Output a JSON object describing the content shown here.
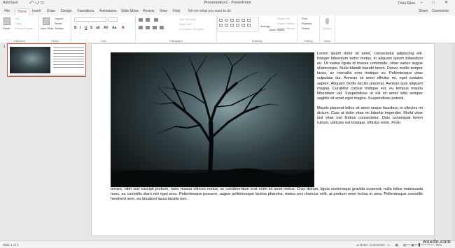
{
  "titlebar": {
    "autosave": "AutoSave",
    "qat": "⤺ ⤻ ▭",
    "title": "Presentation1 - PowerPoint",
    "user": "Tricia Goss",
    "controls": "▭ – □ ✕"
  },
  "tabs": [
    {
      "label": "File"
    },
    {
      "label": "Home"
    },
    {
      "label": "Insert"
    },
    {
      "label": "Draw"
    },
    {
      "label": "Design"
    },
    {
      "label": "Transitions"
    },
    {
      "label": "Animations"
    },
    {
      "label": "Slide Show"
    },
    {
      "label": "Review"
    },
    {
      "label": "View"
    },
    {
      "label": "Help"
    }
  ],
  "tell_me": "Tell me what you want to do",
  "share": "Share",
  "comments": "Comments",
  "ribbon": {
    "clipboard": {
      "label": "Clipboard",
      "paste": "Paste",
      "cut": "Cut",
      "copy": "Copy",
      "format_painter": "Format Painter"
    },
    "slides": {
      "label": "Slides",
      "new_slide": "New Slide",
      "layout": "Layout",
      "reset": "Reset",
      "section": "Section"
    },
    "font": {
      "label": "Font",
      "bold": "B",
      "italic": "I",
      "underline": "U",
      "strike": "S",
      "ab": "ab",
      "av": "AV",
      "aa": "Aa",
      "a": "A"
    },
    "paragraph": {
      "label": "Paragraph",
      "text_direction": "Text Direction",
      "align_text": "Align Text",
      "convert_smartart": "Convert to SmartArt"
    },
    "drawing": {
      "label": "Drawing",
      "arrange": "Arrange",
      "quick_styles": "Quick Styles",
      "shape_fill": "Shape Fill",
      "shape_outline": "Shape Outline",
      "shape_effects": "Shape Effects"
    },
    "editing": {
      "label": "Editing",
      "find": "Find",
      "replace": "Replace",
      "select": "Select"
    },
    "voice": {
      "label": "Voice",
      "dictate": "Dictate"
    }
  },
  "thumbnail": {
    "number": "1"
  },
  "slide": {
    "side_paragraphs": [
      "Lorem ipsum dolor sit amet, consectetur adipiscing elit. Integer bibendum tortor metus, in aliquam ipsum bibendum eu. Ut varius ligula id massa commodo, vitae varius augue ullamcorper. Nulla blandit blandit lorem. Donec mollis tempor lacus, ac convallis eros tristique eu. Pellentesque vitae vulputate dui. Aenean sit amet efficitur mi, eget sodales sapien. Aliquam mollis iaculis placerat. Aenean quis aliquam magna. Curabitur cursus tristique est, eu tempus mauris bibendum vel. Suspendisse ut elit sit amet odio semper sagittis sit amet eget magna. Suspendisse potenti.",
      "Mauris placerat tellus sit amet neque faucibus, in ultricies mi dictum. Cras ut dolor vitae mi lobortis imperdiet. Morbi vitae nisl vitae nisl finibus consectetur. Duis consequat lorem rutrum, ultricies est tristique, efficitur enim. Proin"
    ],
    "bottom_paragraph": "ornare, nibh sed suscipit pretium, nunc massa ultrices metus, ac condimentum erat enim sit amet metus. Cras dictum, ligula scelerisque gravida euismod, nulla tellus malesuada nunc, ac convallis diam nisi eget arcu. Pellentesque posuere, augue pellentesque lacinia pharetra, metus orci rhoncus velit, at pretium enim lectus in urna. Pellentesque convallis hendrerit sem, eu tincidunt lacus iaculis non."
  },
  "statusbar": {
    "slide_of": "Slide 1 of 1",
    "notes": "≐ Notes",
    "comments": "Comments",
    "views": "▭ ▦ ▤ ▣",
    "zoom": "75%"
  },
  "watermark": "wsxdn.com"
}
